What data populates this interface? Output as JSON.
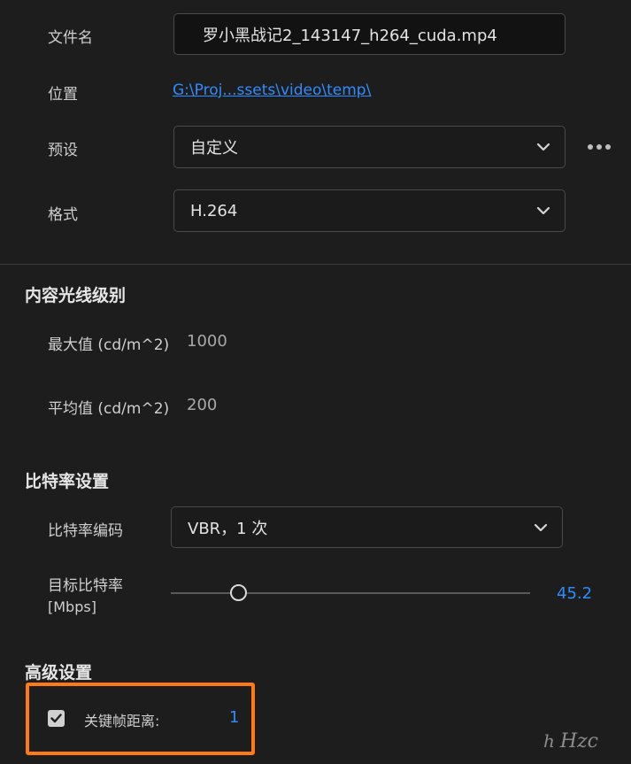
{
  "output": {
    "filename_label": "文件名",
    "filename_value": "罗小黑战记2_143147_h264_cuda.mp4",
    "location_label": "位置",
    "location_value": "G:\\Proj...ssets\\video\\temp\\",
    "preset_label": "预设",
    "preset_value": "自定义",
    "format_label": "格式",
    "format_value": "H.264"
  },
  "content_light": {
    "title": "内容光线级别",
    "max_label": "最大值 (cd/m^2)",
    "max_value": "1000",
    "avg_label": "平均值 (cd/m^2)",
    "avg_value": "200"
  },
  "bitrate": {
    "title": "比特率设置",
    "encoding_label": "比特率编码",
    "encoding_value": "VBR，1 次",
    "target_label_line1": "目标比特率",
    "target_label_line2": "[Mbps]",
    "target_value": "45.2",
    "slider_fraction": 0.19
  },
  "advanced": {
    "title": "高级设置",
    "keyframe_label": "关键帧距离:",
    "keyframe_value": "1",
    "keyframe_checked": true
  },
  "watermark": {
    "text": "Hzc",
    "glyph": "h"
  },
  "colors": {
    "accent_blue": "#2f8cff",
    "highlight_orange": "#ff7a14",
    "background": "#1d1d1d"
  }
}
